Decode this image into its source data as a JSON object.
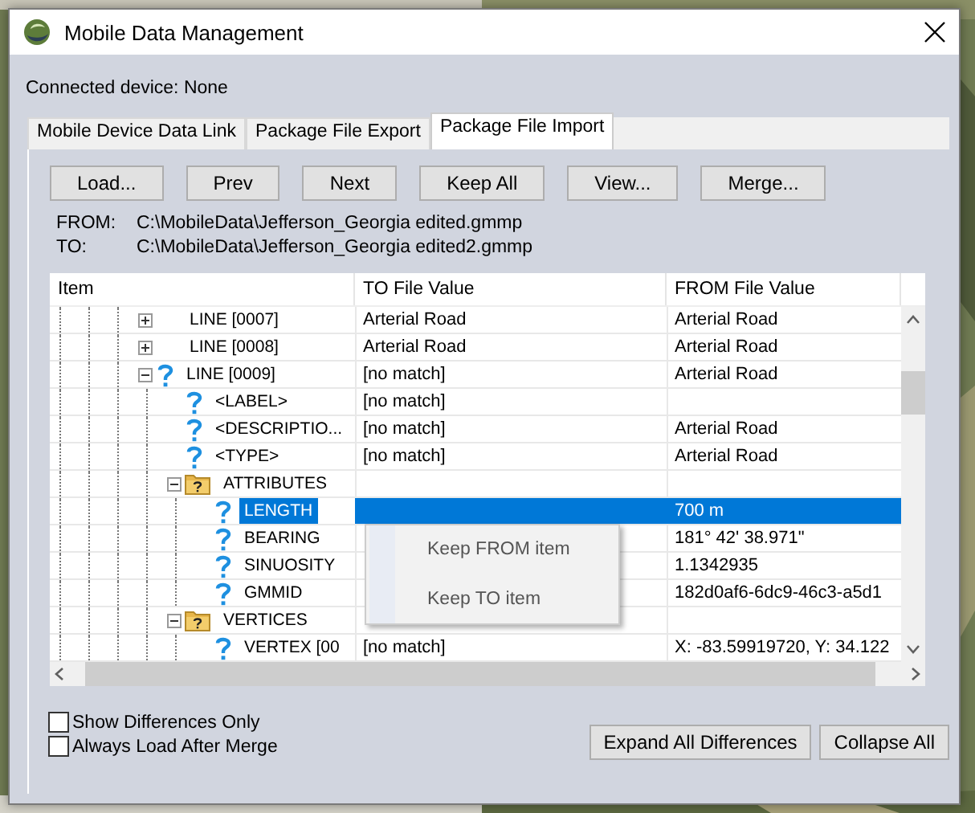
{
  "window": {
    "title": "Mobile Data Management"
  },
  "connected_device": "Connected device: None",
  "tabs": [
    {
      "label": "Mobile Device Data Link",
      "selected": false
    },
    {
      "label": "Package File Export",
      "selected": false
    },
    {
      "label": "Package File Import",
      "selected": true
    }
  ],
  "buttons": [
    "Load...",
    "Prev",
    "Next",
    "Keep All",
    "View...",
    "Merge..."
  ],
  "paths": [
    {
      "label": "FROM:",
      "value": "C:\\MobileData\\Jefferson_Georgia edited.gmmp"
    },
    {
      "label": "TO:",
      "value": "C:\\MobileData\\Jefferson_Georgia edited2.gmmp"
    }
  ],
  "table": {
    "columns": [
      "Item",
      "TO File Value",
      "FROM File Value"
    ],
    "rows": [
      {
        "label": "LINE [0007]",
        "kind": "none",
        "expanded": false,
        "selected": false,
        "to": "Arterial Road",
        "from": "Arterial Road"
      },
      {
        "label": "LINE [0008]",
        "kind": "none",
        "expanded": false,
        "selected": false,
        "to": "Arterial Road",
        "from": "Arterial Road"
      },
      {
        "label": "LINE [0009]",
        "kind": "question",
        "expanded": true,
        "selected": false,
        "to": "[no match]",
        "from": "Arterial Road",
        "children": [
          {
            "label": "<LABEL>",
            "kind": "question",
            "selected": false,
            "to": "[no match]"
          },
          {
            "label": "<DESCRIPTIO...",
            "kind": "question",
            "selected": false,
            "to": "[no match]",
            "from": "Arterial Road"
          },
          {
            "label": "<TYPE>",
            "kind": "question",
            "selected": false,
            "to": "[no match]",
            "from": "Arterial Road"
          },
          {
            "label": "ATTRIBUTES",
            "kind": "folder",
            "expanded": true,
            "selected": false,
            "children": [
              {
                "label": "LENGTH",
                "kind": "question",
                "selected": true,
                "from": "700 m"
              },
              {
                "label": "BEARING",
                "kind": "question",
                "selected": false,
                "from": "181° 42' 38.971\""
              },
              {
                "label": "SINUOSITY",
                "kind": "question",
                "selected": false,
                "from": "1.1342935"
              },
              {
                "label": "GMMID",
                "kind": "question",
                "selected": false,
                "from": "182d0af6-6dc9-46c3-a5d1"
              }
            ]
          },
          {
            "label": "VERTICES",
            "kind": "folder",
            "expanded": true,
            "selected": false,
            "children": [
              {
                "label": "VERTEX [00",
                "kind": "question",
                "selected": false,
                "to": "[no match]",
                "from": "X: -83.59919720, Y: 34.122"
              }
            ]
          }
        ]
      }
    ]
  },
  "context_menu": [
    "Keep FROM item",
    "Keep TO item"
  ],
  "checkboxes": [
    {
      "label": "Show Differences Only",
      "checked": false
    },
    {
      "label": "Always Load After Merge",
      "checked": false
    }
  ],
  "bottom_buttons": [
    "Expand All Differences",
    "Collapse All"
  ]
}
